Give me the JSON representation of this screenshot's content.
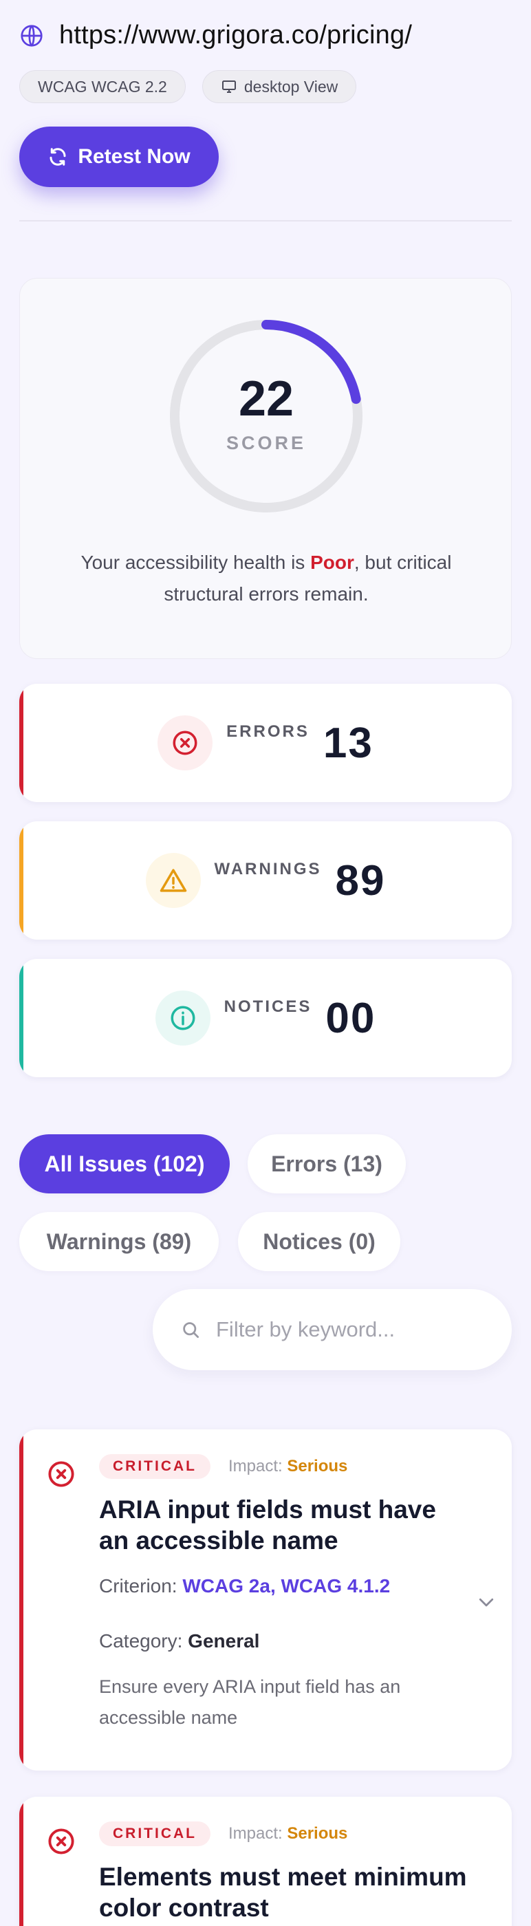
{
  "header": {
    "url": "https://www.grigora.co/pricing/",
    "pills": [
      {
        "icon": "globe-icon",
        "label": "WCAG WCAG 2.2"
      },
      {
        "icon": "monitor-icon",
        "label": "desktop View"
      }
    ],
    "retest_label": "Retest Now"
  },
  "score": {
    "value": "22",
    "label": "SCORE",
    "fraction": 0.22,
    "health_prefix": "Your accessibility health is ",
    "health_word": "Poor",
    "health_suffix": ", but critical structural errors remain."
  },
  "stats": [
    {
      "label": "ERRORS",
      "value": "13",
      "color": "#d32030"
    },
    {
      "label": "WARNINGS",
      "value": "89",
      "color": "#f5a524"
    },
    {
      "label": "NOTICES",
      "value": "00",
      "color": "#1fb8a0"
    }
  ],
  "filters": {
    "all": "All Issues (102)",
    "errors": "Errors (13)",
    "warnings": "Warnings (89)",
    "notices": "Notices (0)",
    "search_placeholder": "Filter by keyword..."
  },
  "issues": [
    {
      "severity": "CRITICAL",
      "impact_label": "Impact: ",
      "impact_value": "Serious",
      "title": "ARIA input fields must have an accessible name",
      "criterion_label": "Criterion: ",
      "criterion_value": "WCAG 2a, WCAG 4.1.2",
      "category_label": "Category: ",
      "category_value": "General",
      "description": "Ensure every ARIA input field has an accessible name"
    },
    {
      "severity": "CRITICAL",
      "impact_label": "Impact: ",
      "impact_value": "Serious",
      "title": "Elements must meet minimum color contrast"
    }
  ],
  "colors": {
    "accent": "#5b3fe0",
    "error": "#d32030",
    "warning": "#f5a524",
    "notice": "#1fb8a0",
    "background": "#f5f3fe"
  }
}
